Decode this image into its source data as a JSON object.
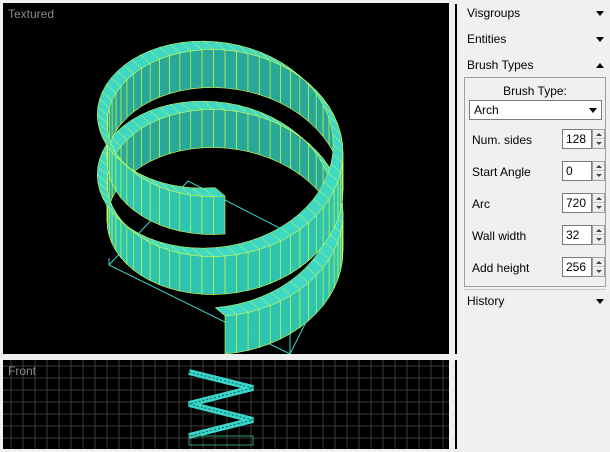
{
  "viewports": {
    "textured_label": "Textured",
    "front_label": "Front"
  },
  "panel": {
    "sections": [
      {
        "label": "Visgroups",
        "expanded": false
      },
      {
        "label": "Entities",
        "expanded": false
      },
      {
        "label": "Brush Types",
        "expanded": true
      },
      {
        "label": "History",
        "expanded": false
      }
    ],
    "brush_types": {
      "title": "Brush Type:",
      "selected": "Arch",
      "properties": [
        {
          "label": "Num. sides",
          "value": "128"
        },
        {
          "label": "Start Angle",
          "value": "0"
        },
        {
          "label": "Arc",
          "value": "720"
        },
        {
          "label": "Wall width",
          "value": "32"
        },
        {
          "label": "Add height",
          "value": "256"
        }
      ]
    }
  },
  "colors": {
    "solid_fill": "#2ec4b0",
    "solid_edge": "#d6ff4a",
    "bbox": "#3ad6c8",
    "grid": "#3a3a3a",
    "viewport_bg": "#000000"
  },
  "icons": {
    "collapsed": "triangle-down-icon",
    "expanded": "triangle-up-icon"
  }
}
